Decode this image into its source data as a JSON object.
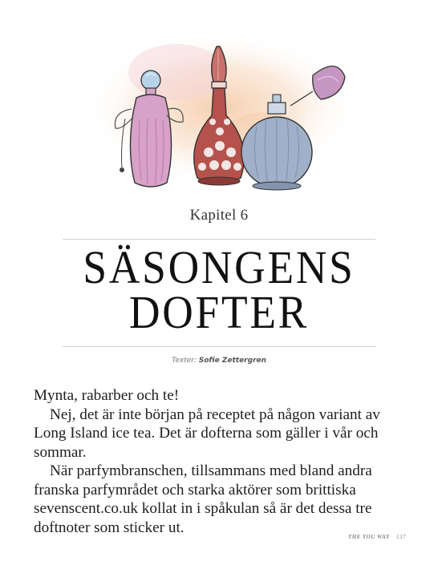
{
  "chapter": {
    "kicker": "Kapitel 6",
    "title_line1": "SÄSONGENS",
    "title_line2": "DOFTER"
  },
  "byline": {
    "label": "Texter:",
    "author": "Sofie Zettergren"
  },
  "body": {
    "p1": "Mynta, rabarber och te!",
    "p2": "Nej, det är inte början på receptet på någon variant av Long Island ice tea. Det är dofterna som gäller i vår och sommar.",
    "p3": "När parfymbranschen, tillsammans med bland andra franska parfymrådet och starka aktörer som brittiska sevenscent.co.uk kollat in i spåkulan så är det dessa tre doftnoter som sticker ut."
  },
  "footer": {
    "publication": "THE YOU WAY",
    "page": "137"
  },
  "colors": {
    "pink_bottle": "#c98fb8",
    "red_bottle": "#b5524c",
    "blue_bottle": "#9fb0c8",
    "splash": "#f4c9a8"
  }
}
